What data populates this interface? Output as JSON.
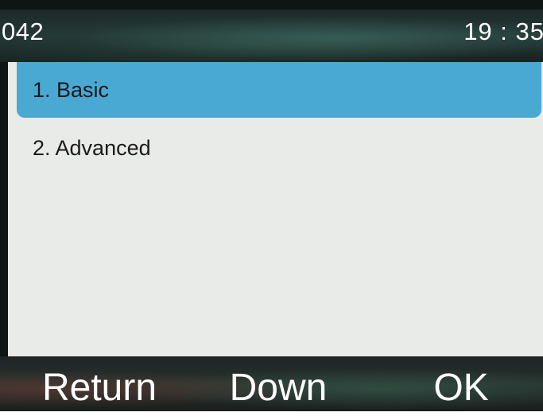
{
  "status_bar": {
    "account": "042",
    "time": "19 : 35"
  },
  "menu": {
    "items": [
      {
        "label": "1. Basic",
        "selected": true
      },
      {
        "label": "2. Advanced",
        "selected": false
      }
    ]
  },
  "softkeys": {
    "return_label": "Return",
    "down_label": "Down",
    "ok_label": "OK"
  },
  "colors": {
    "selection": "#4aa9d3",
    "panel_background": "#e9ebe8",
    "bar_text": "#ffffff"
  }
}
